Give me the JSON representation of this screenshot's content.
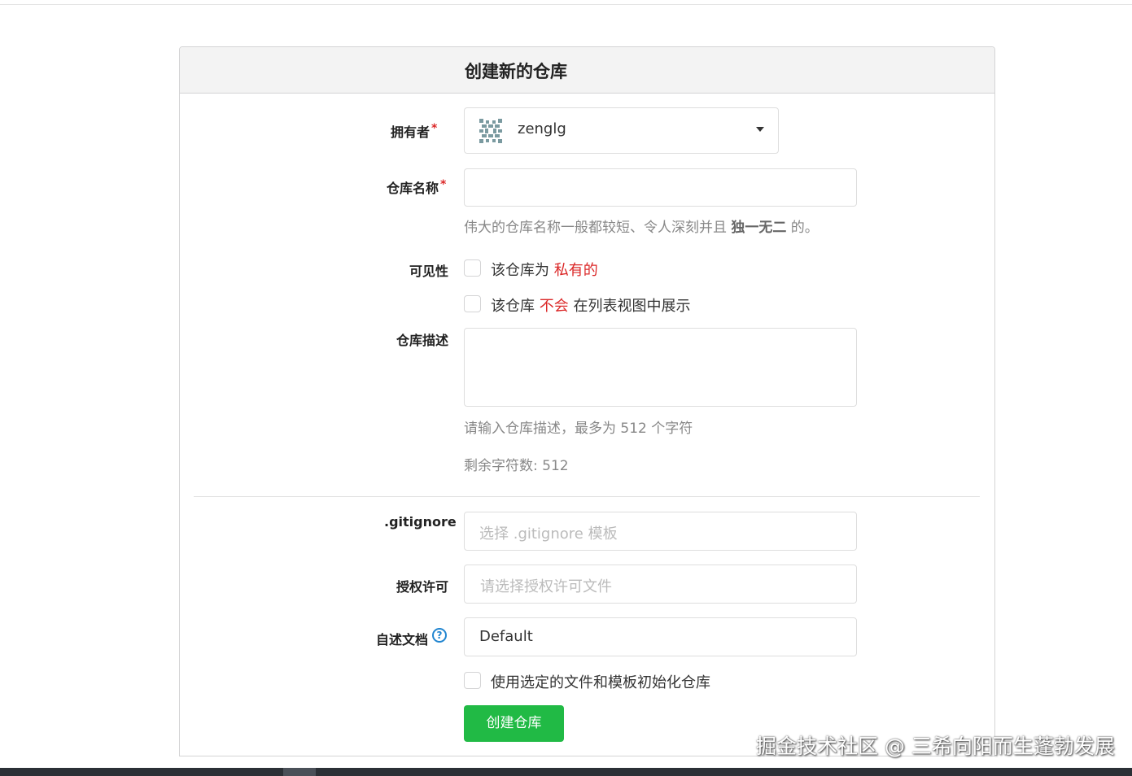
{
  "header": {
    "title": "创建新的仓库"
  },
  "owner": {
    "label": "拥有者",
    "required_mark": "*",
    "value": "zenglg",
    "avatar_icon": "identicon-avatar",
    "dropdown_icon": "caret-down-icon"
  },
  "repo_name": {
    "label": "仓库名称",
    "required_mark": "*",
    "value": "",
    "help_prefix": "伟大的仓库名称一般都较短、令人深刻并且 ",
    "help_bold": "独一无二",
    "help_suffix": " 的。"
  },
  "visibility": {
    "label": "可见性",
    "private_prefix": "该仓库为 ",
    "private_highlight": "私有的",
    "template_prefix": "该仓库 ",
    "template_highlight": "不会",
    "template_suffix": " 在列表视图中展示"
  },
  "description": {
    "label": "仓库描述",
    "value": "",
    "help": "请输入仓库描述，最多为 512 个字符",
    "remaining": "剩余字符数: 512"
  },
  "gitignore": {
    "label": ".gitignore",
    "placeholder": "选择 .gitignore 模板"
  },
  "license": {
    "label": "授权许可",
    "placeholder": "请选择授权许可文件"
  },
  "readme": {
    "label": "自述文档",
    "value": "Default",
    "help_icon": "question-circle-icon"
  },
  "auto_init": {
    "label": "使用选定的文件和模板初始化仓库"
  },
  "submit": {
    "label": "创建仓库"
  },
  "watermark": "掘金技术社区 @ 三希向阳而生蓬勃发展",
  "colors": {
    "accent_green": "#21ba45",
    "required_red": "#db2828",
    "info_blue": "#2185d0"
  }
}
